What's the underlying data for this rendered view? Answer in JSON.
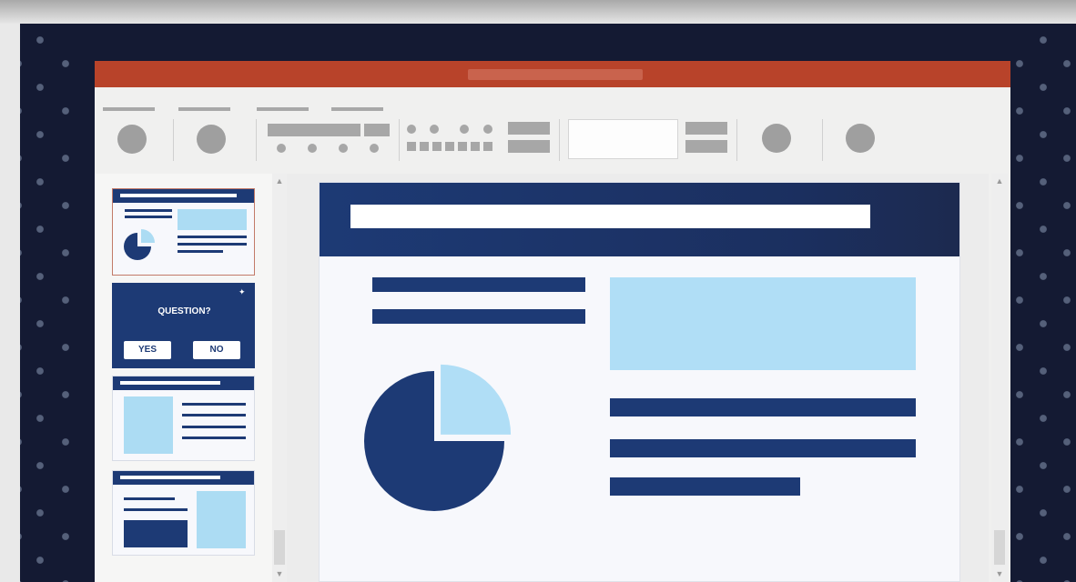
{
  "thumbnails": {
    "question_slide": {
      "question": "QUESTION?",
      "yes_label": "YES",
      "no_label": "NO"
    }
  },
  "colors": {
    "title_bar": "#b8432a",
    "slide_navy": "#1d3a75",
    "slide_light_blue": "#b0def6",
    "background_dark": "#141a33"
  },
  "icons": {
    "scroll_up": "▲",
    "scroll_down": "▼",
    "sparkle": "✦"
  },
  "chart_data": {
    "type": "pie",
    "values": [
      75,
      25
    ],
    "exploded_slice_index": 1,
    "colors": [
      "#1d3a75",
      "#b0def6"
    ]
  }
}
